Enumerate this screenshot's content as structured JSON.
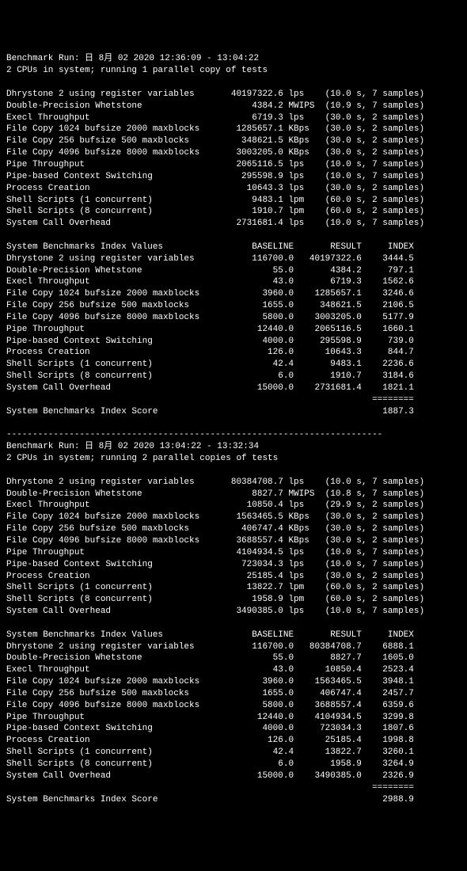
{
  "run1": {
    "header1": "Benchmark Run: 日 8月 02 2020 12:36:09 - 13:04:22",
    "header2": "2 CPUs in system; running 1 parallel copy of tests",
    "tests": [
      {
        "name": "Dhrystone 2 using register variables",
        "value": "40197322.6",
        "unit": "lps",
        "time": "10.0",
        "samples": "7"
      },
      {
        "name": "Double-Precision Whetstone",
        "value": "4384.2",
        "unit": "MWIPS",
        "time": "10.9",
        "samples": "7"
      },
      {
        "name": "Execl Throughput",
        "value": "6719.3",
        "unit": "lps",
        "time": "30.0",
        "samples": "2"
      },
      {
        "name": "File Copy 1024 bufsize 2000 maxblocks",
        "value": "1285657.1",
        "unit": "KBps",
        "time": "30.0",
        "samples": "2"
      },
      {
        "name": "File Copy 256 bufsize 500 maxblocks",
        "value": "348621.5",
        "unit": "KBps",
        "time": "30.0",
        "samples": "2"
      },
      {
        "name": "File Copy 4096 bufsize 8000 maxblocks",
        "value": "3003205.0",
        "unit": "KBps",
        "time": "30.0",
        "samples": "2"
      },
      {
        "name": "Pipe Throughput",
        "value": "2065116.5",
        "unit": "lps",
        "time": "10.0",
        "samples": "7"
      },
      {
        "name": "Pipe-based Context Switching",
        "value": "295598.9",
        "unit": "lps",
        "time": "10.0",
        "samples": "7"
      },
      {
        "name": "Process Creation",
        "value": "10643.3",
        "unit": "lps",
        "time": "30.0",
        "samples": "2"
      },
      {
        "name": "Shell Scripts (1 concurrent)",
        "value": "9483.1",
        "unit": "lpm",
        "time": "60.0",
        "samples": "2"
      },
      {
        "name": "Shell Scripts (8 concurrent)",
        "value": "1910.7",
        "unit": "lpm",
        "time": "60.0",
        "samples": "2"
      },
      {
        "name": "System Call Overhead",
        "value": "2731681.4",
        "unit": "lps",
        "time": "10.0",
        "samples": "7"
      }
    ],
    "indexHeader": {
      "title": "System Benchmarks Index Values",
      "c1": "BASELINE",
      "c2": "RESULT",
      "c3": "INDEX"
    },
    "index": [
      {
        "name": "Dhrystone 2 using register variables",
        "baseline": "116700.0",
        "result": "40197322.6",
        "idx": "3444.5"
      },
      {
        "name": "Double-Precision Whetstone",
        "baseline": "55.0",
        "result": "4384.2",
        "idx": "797.1"
      },
      {
        "name": "Execl Throughput",
        "baseline": "43.0",
        "result": "6719.3",
        "idx": "1562.6"
      },
      {
        "name": "File Copy 1024 bufsize 2000 maxblocks",
        "baseline": "3960.0",
        "result": "1285657.1",
        "idx": "3246.6"
      },
      {
        "name": "File Copy 256 bufsize 500 maxblocks",
        "baseline": "1655.0",
        "result": "348621.5",
        "idx": "2106.5"
      },
      {
        "name": "File Copy 4096 bufsize 8000 maxblocks",
        "baseline": "5800.0",
        "result": "3003205.0",
        "idx": "5177.9"
      },
      {
        "name": "Pipe Throughput",
        "baseline": "12440.0",
        "result": "2065116.5",
        "idx": "1660.1"
      },
      {
        "name": "Pipe-based Context Switching",
        "baseline": "4000.0",
        "result": "295598.9",
        "idx": "739.0"
      },
      {
        "name": "Process Creation",
        "baseline": "126.0",
        "result": "10643.3",
        "idx": "844.7"
      },
      {
        "name": "Shell Scripts (1 concurrent)",
        "baseline": "42.4",
        "result": "9483.1",
        "idx": "2236.6"
      },
      {
        "name": "Shell Scripts (8 concurrent)",
        "baseline": "6.0",
        "result": "1910.7",
        "idx": "3184.6"
      },
      {
        "name": "System Call Overhead",
        "baseline": "15000.0",
        "result": "2731681.4",
        "idx": "1821.1"
      }
    ],
    "scoreLabel": "System Benchmarks Index Score",
    "score": "1887.3"
  },
  "run2": {
    "header1": "Benchmark Run: 日 8月 02 2020 13:04:22 - 13:32:34",
    "header2": "2 CPUs in system; running 2 parallel copies of tests",
    "tests": [
      {
        "name": "Dhrystone 2 using register variables",
        "value": "80384708.7",
        "unit": "lps",
        "time": "10.0",
        "samples": "7"
      },
      {
        "name": "Double-Precision Whetstone",
        "value": "8827.7",
        "unit": "MWIPS",
        "time": "10.8",
        "samples": "7"
      },
      {
        "name": "Execl Throughput",
        "value": "10850.4",
        "unit": "lps",
        "time": "29.9",
        "samples": "2"
      },
      {
        "name": "File Copy 1024 bufsize 2000 maxblocks",
        "value": "1563465.5",
        "unit": "KBps",
        "time": "30.0",
        "samples": "2"
      },
      {
        "name": "File Copy 256 bufsize 500 maxblocks",
        "value": "406747.4",
        "unit": "KBps",
        "time": "30.0",
        "samples": "2"
      },
      {
        "name": "File Copy 4096 bufsize 8000 maxblocks",
        "value": "3688557.4",
        "unit": "KBps",
        "time": "30.0",
        "samples": "2"
      },
      {
        "name": "Pipe Throughput",
        "value": "4104934.5",
        "unit": "lps",
        "time": "10.0",
        "samples": "7"
      },
      {
        "name": "Pipe-based Context Switching",
        "value": "723034.3",
        "unit": "lps",
        "time": "10.0",
        "samples": "7"
      },
      {
        "name": "Process Creation",
        "value": "25185.4",
        "unit": "lps",
        "time": "30.0",
        "samples": "2"
      },
      {
        "name": "Shell Scripts (1 concurrent)",
        "value": "13822.7",
        "unit": "lpm",
        "time": "60.0",
        "samples": "2"
      },
      {
        "name": "Shell Scripts (8 concurrent)",
        "value": "1958.9",
        "unit": "lpm",
        "time": "60.0",
        "samples": "2"
      },
      {
        "name": "System Call Overhead",
        "value": "3490385.0",
        "unit": "lps",
        "time": "10.0",
        "samples": "7"
      }
    ],
    "indexHeader": {
      "title": "System Benchmarks Index Values",
      "c1": "BASELINE",
      "c2": "RESULT",
      "c3": "INDEX"
    },
    "index": [
      {
        "name": "Dhrystone 2 using register variables",
        "baseline": "116700.0",
        "result": "80384708.7",
        "idx": "6888.1"
      },
      {
        "name": "Double-Precision Whetstone",
        "baseline": "55.0",
        "result": "8827.7",
        "idx": "1605.0"
      },
      {
        "name": "Execl Throughput",
        "baseline": "43.0",
        "result": "10850.4",
        "idx": "2523.4"
      },
      {
        "name": "File Copy 1024 bufsize 2000 maxblocks",
        "baseline": "3960.0",
        "result": "1563465.5",
        "idx": "3948.1"
      },
      {
        "name": "File Copy 256 bufsize 500 maxblocks",
        "baseline": "1655.0",
        "result": "406747.4",
        "idx": "2457.7"
      },
      {
        "name": "File Copy 4096 bufsize 8000 maxblocks",
        "baseline": "5800.0",
        "result": "3688557.4",
        "idx": "6359.6"
      },
      {
        "name": "Pipe Throughput",
        "baseline": "12440.0",
        "result": "4104934.5",
        "idx": "3299.8"
      },
      {
        "name": "Pipe-based Context Switching",
        "baseline": "4000.0",
        "result": "723034.3",
        "idx": "1807.6"
      },
      {
        "name": "Process Creation",
        "baseline": "126.0",
        "result": "25185.4",
        "idx": "1998.8"
      },
      {
        "name": "Shell Scripts (1 concurrent)",
        "baseline": "42.4",
        "result": "13822.7",
        "idx": "3260.1"
      },
      {
        "name": "Shell Scripts (8 concurrent)",
        "baseline": "6.0",
        "result": "1958.9",
        "idx": "3264.9"
      },
      {
        "name": "System Call Overhead",
        "baseline": "15000.0",
        "result": "3490385.0",
        "idx": "2326.9"
      }
    ],
    "scoreLabel": "System Benchmarks Index Score",
    "score": "2988.9"
  },
  "divider": "------------------------------------------------------------------------",
  "eqline": "========"
}
